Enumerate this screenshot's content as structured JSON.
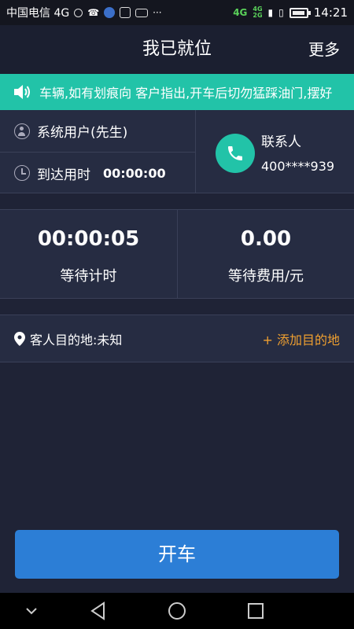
{
  "statusbar": {
    "carrier": "中国电信 4G",
    "net1": "4G",
    "net2": "4G\n2G",
    "time": "14:21"
  },
  "header": {
    "title": "我已就位",
    "more": "更多"
  },
  "notice": {
    "text": "车辆,如有划痕向 客户指出,开车后切勿猛踩油门,摆好"
  },
  "passenger": {
    "name": "系统用户(先生)",
    "arrival_label": "到达用时",
    "arrival_time": "00:00:00"
  },
  "contact": {
    "label": "联系人",
    "number": "400****939"
  },
  "waiting": {
    "timer": "00:00:05",
    "timer_label": "等待计时",
    "fee": "0.00",
    "fee_label": "等待费用/元"
  },
  "destination": {
    "text": "客人目的地:未知",
    "add": "+ 添加目的地"
  },
  "start_button": "开车",
  "colors": {
    "accent_teal": "#22c3a8",
    "button_blue": "#2c7ed6",
    "add_orange": "#f0a030",
    "background": "#1f2336",
    "panel": "#262c42"
  },
  "icons": [
    "speaker-icon",
    "user-icon",
    "clock-icon",
    "phone-icon",
    "location-pin-icon",
    "back-icon",
    "home-icon",
    "recents-icon"
  ]
}
